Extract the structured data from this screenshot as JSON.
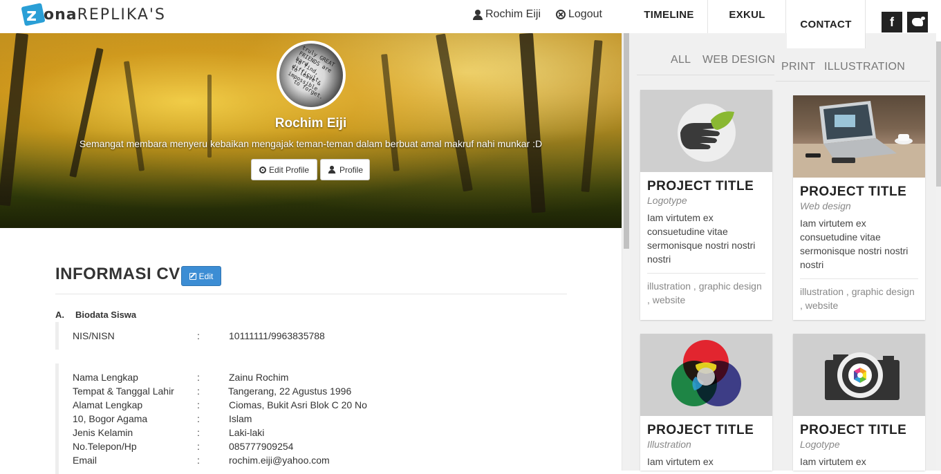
{
  "brand": {
    "logo_mark": "z",
    "logo_bold": "ona",
    "logo_rest": "REPLIKA'S"
  },
  "nav": {
    "user_name": "Rochim Eiji",
    "logout_label": "Logout",
    "tabs": [
      {
        "label": "TIMELINE"
      },
      {
        "label": "EXKUL"
      },
      {
        "label": "CONTACT"
      }
    ],
    "social": {
      "facebook": "f",
      "twitter_icon": "twitter-bird-icon"
    }
  },
  "profile": {
    "name": "Rochim Eiji",
    "bio": "Semangat membara menyeru kebaikan mengajak teman-teman dalam berbuat amal makruf nahi munkar :D",
    "edit_profile_label": "Edit Profile",
    "profile_label": "Profile",
    "avatar_text": [
      "truly GREAT",
      "FRIENDS are hard",
      "to find, difficult",
      "to leave & impossible",
      "to forget."
    ]
  },
  "cv": {
    "title": "INFORMASI CV",
    "edit_label": "Edit",
    "section_letter": "A.",
    "section_title": "Biodata Siswa",
    "separator": ":",
    "nis": {
      "label": "NIS/NISN",
      "value": "10111111/9963835788"
    },
    "fields": [
      {
        "label": "Nama Lengkap",
        "value": "Zainu Rochim"
      },
      {
        "label": "Tempat & Tanggal Lahir",
        "value": "Tangerang, 22 Agustus 1996"
      },
      {
        "label": "Alamat Lengkap",
        "value": "Ciomas, Bukit Asri Blok C 20 No"
      },
      {
        "label": "10, Bogor Agama",
        "value": "Islam"
      },
      {
        "label": "Jenis Kelamin",
        "value": "Laki-laki"
      },
      {
        "label": "No.Telepon/Hp",
        "value": "085777909254"
      },
      {
        "label": "Email",
        "value": "rochim.eiji@yahoo.com"
      }
    ]
  },
  "portfolio": {
    "filters": [
      "ALL",
      "WEB DESIGN",
      "PRINT",
      "ILLUSTRATION"
    ],
    "cards": [
      {
        "title": "PROJECT TITLE",
        "category": "Logotype",
        "text": "Iam virtutem ex consuetudine vitae sermonisque nostri nostri nostri",
        "tags": "illustration , graphic design , website",
        "image": "leaf-hand-logo"
      },
      {
        "title": "PROJECT TITLE",
        "category": "Web design",
        "text": "Iam virtutem ex consuetudine vitae sermonisque nostri nostri nostri",
        "tags": "illustration , graphic design , website",
        "image": "laptop-desk-photo"
      },
      {
        "title": "PROJECT TITLE",
        "category": "Illustration",
        "text": "Iam virtutem ex",
        "image": "rgb-color-wheel"
      },
      {
        "title": "PROJECT TITLE",
        "category": "Logotype",
        "text": "Iam virtutem ex",
        "image": "camera-logo"
      }
    ]
  },
  "colors": {
    "accent_blue": "#3c8dd4",
    "logo_blue": "#2a9fd6",
    "panel_bg": "#f0f0f0"
  }
}
